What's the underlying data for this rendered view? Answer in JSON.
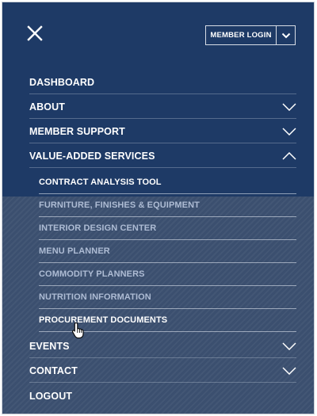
{
  "header": {
    "login_label": "MEMBER LOGIN"
  },
  "menu": {
    "dashboard": "DASHBOARD",
    "about": "ABOUT",
    "member_support": "MEMBER SUPPORT",
    "value_added": "VALUE-ADDED SERVICES",
    "sub_items": [
      "CONTRACT ANALYSIS TOOL",
      "FURNITURE, FINISHES & EQUIPMENT",
      "INTERIOR DESIGN CENTER",
      "MENU PLANNER",
      "COMMODITY PLANNERS",
      "NUTRITION INFORMATION",
      "PROCUREMENT DOCUMENTS"
    ],
    "events": "EVENTS",
    "contact": "CONTACT",
    "logout": "LOGOUT"
  },
  "colors": {
    "panel": "#1e3a66",
    "submenu_bg": "#3b4f6f",
    "text": "#ffffff",
    "dim_text": "#aebcd4"
  },
  "icons": {
    "close": "close-icon",
    "login_dropdown": "chevron-down-icon",
    "expand": "chevron-down-icon",
    "collapse": "chevron-up-icon",
    "cursor": "hand-pointer-icon"
  }
}
